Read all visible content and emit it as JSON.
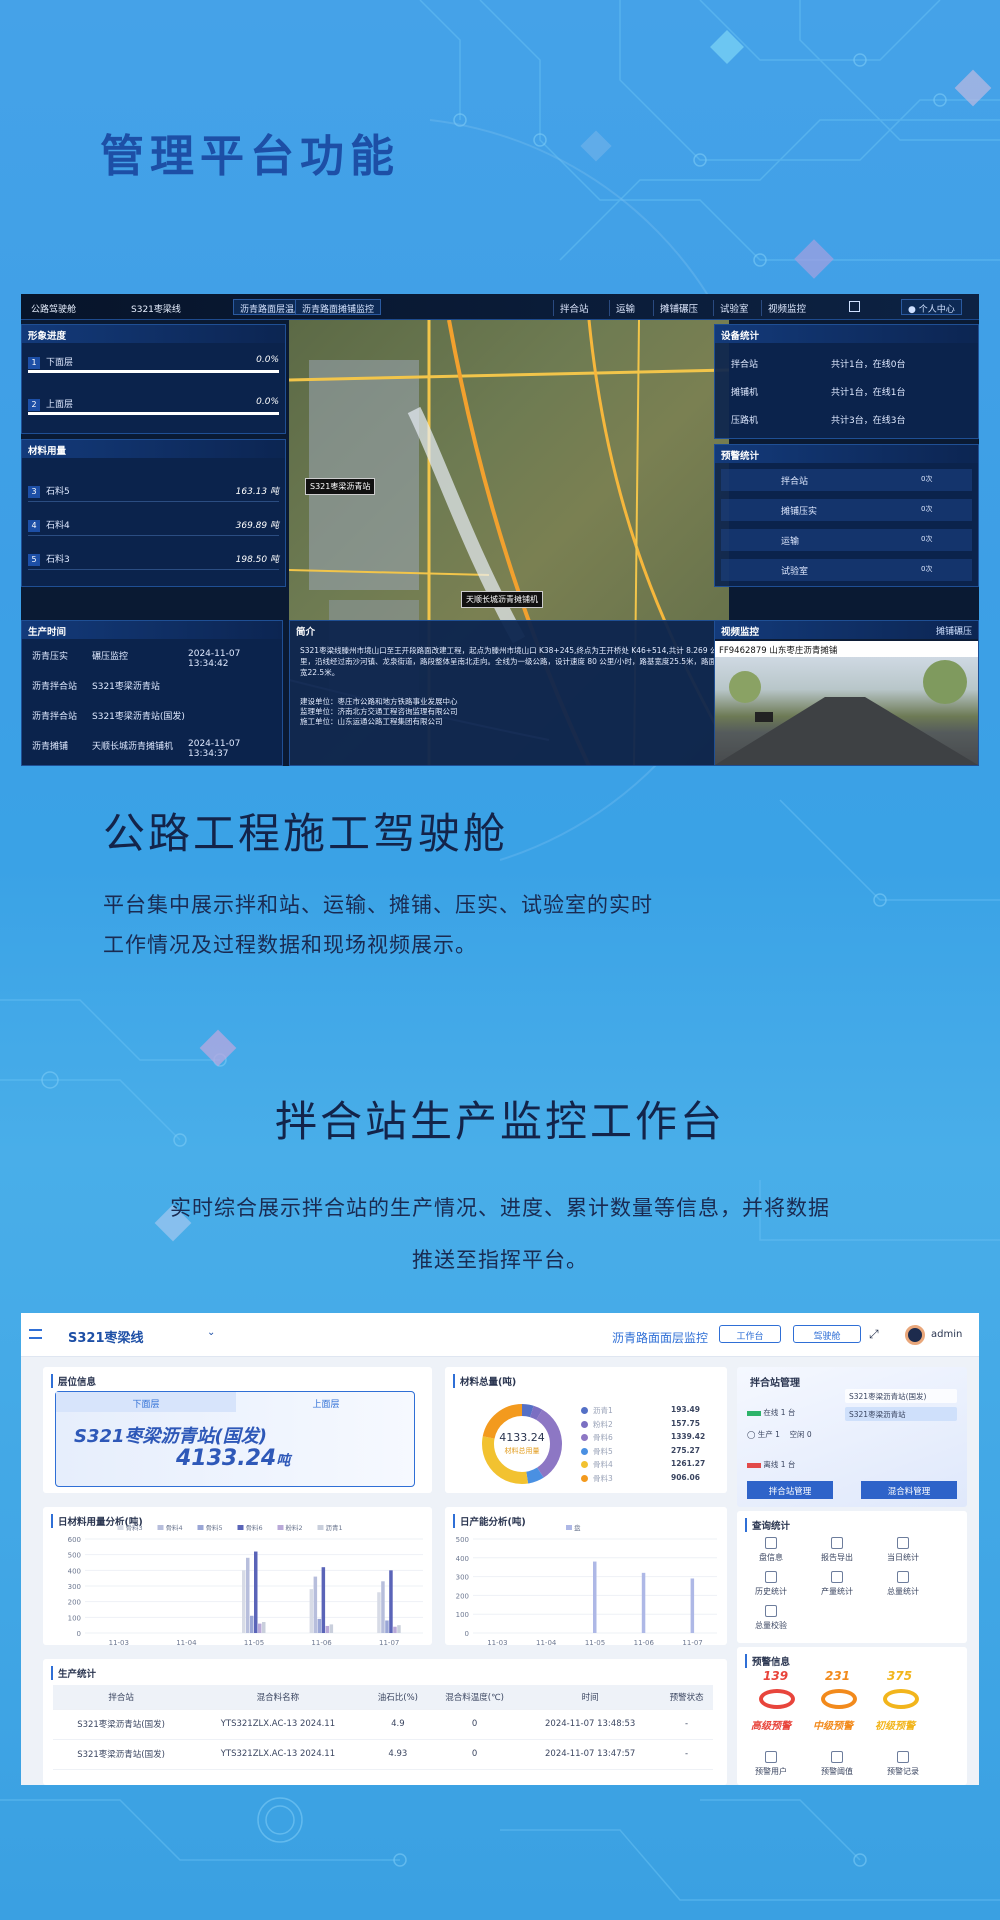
{
  "heading": "管理平台功能",
  "d1": {
    "platform": "公路驾驶舱",
    "project": "S321枣梁线",
    "tabs": [
      "沥青路面层温度监控",
      "沥青路面摊铺监控"
    ],
    "nav": [
      "拌合站",
      "运输",
      "摊铺碾压",
      "试验室",
      "视频监控"
    ],
    "user": "个人中心",
    "progress": {
      "title": "形象进度",
      "rows": [
        {
          "name": "下面层",
          "value": "0.0%"
        },
        {
          "name": "上面层",
          "value": "0.0%"
        }
      ]
    },
    "materials": {
      "title": "材料用量",
      "rows": [
        {
          "name": "石料5",
          "value": "163.13 吨"
        },
        {
          "name": "石料4",
          "value": "369.89 吨"
        },
        {
          "name": "石料3",
          "value": "198.50 吨"
        }
      ]
    },
    "prodtime": {
      "title": "生产时间",
      "rows": [
        {
          "a": "沥青压实",
          "b": "碾压监控",
          "c": "2024-11-07 13:34:42"
        },
        {
          "a": "沥青拌合站",
          "b": "S321枣梁沥青站",
          "c": ""
        },
        {
          "a": "沥青拌合站",
          "b": "S321枣梁沥青站(国发)",
          "c": ""
        },
        {
          "a": "沥青摊铺",
          "b": "天顺长城沥青摊铺机",
          "c": "2024-11-07 13:34:37"
        }
      ]
    },
    "map": {
      "label1": "S321枣梁沥青站",
      "label2": "天顺长城沥青摊铺机"
    },
    "intro": {
      "title": "简介",
      "text": "S321枣梁线滕州市境山口至王开段路面改建工程，起点为滕州市境山口 K38+245,终点为王开桥处 K46+514,共计 8.269 公里，沿线经过南沙河镇、龙泉街道，路段整体呈南北走向。全线为一级公路，设计速度 80 公里/小时，路基宽度25.5米，路面宽22.5米。",
      "units": [
        "建设单位：枣庄市公路和地方铁路事业发展中心",
        "监理单位：济南北方交通工程咨询监理有限公司",
        "施工单位：山东运通公路工程集团有限公司"
      ]
    },
    "equipment": {
      "title": "设备统计",
      "rows": [
        {
          "name": "拌合站",
          "value": "共计1台，在线0台"
        },
        {
          "name": "摊铺机",
          "value": "共计1台，在线1台"
        },
        {
          "name": "压路机",
          "value": "共计3台，在线3台"
        }
      ]
    },
    "warnings": {
      "title": "预警统计",
      "rows": [
        {
          "name": "拌合站",
          "value": "0次"
        },
        {
          "name": "摊铺压实",
          "value": "0次"
        },
        {
          "name": "运输",
          "value": "0次"
        },
        {
          "name": "试验室",
          "value": "0次"
        }
      ]
    },
    "video": {
      "title": "视频监控",
      "select": "摊铺碾压",
      "camera": "FF9462879 山东枣庄沥青摊铺"
    }
  },
  "section1": {
    "title": "公路工程施工驾驶舱",
    "lines": [
      "平台集中展示拌和站、运输、摊铺、压实、试验室的实时",
      "工作情况及过程数据和现场视频展示。"
    ]
  },
  "section2": {
    "title": "拌合站生产监控工作台",
    "lines": [
      "实时综合展示拌合站的生产情况、进度、累计数量等信息，并将数据",
      "推送至指挥平台。"
    ]
  },
  "d2": {
    "project": "S321枣梁线",
    "page_title": "沥青路面面层监控",
    "btn_workbench": "工作台",
    "btn_cockpit": "驾驶舱",
    "user": "admin",
    "layer": {
      "title": "层位信息",
      "tabs": [
        "下面层",
        "上面层"
      ],
      "station": "S321枣梁沥青站(国发)",
      "value": "4133.24",
      "unit": "吨"
    },
    "total": {
      "title": "材料总量(吨)",
      "center": "4133.24",
      "center_label": "材料总用量",
      "items": [
        {
          "name": "沥青1",
          "value": 193.49,
          "color": "#5470c6"
        },
        {
          "name": "粉料2",
          "value": 157.75,
          "color": "#7b6fc2"
        },
        {
          "name": "骨料6",
          "value": 1339.42,
          "color": "#8d77c4"
        },
        {
          "name": "骨料5",
          "value": 275.27,
          "color": "#4a90e2"
        },
        {
          "name": "骨料4",
          "value": 1261.27,
          "color": "#f2c230"
        },
        {
          "name": "骨料3",
          "value": 906.06,
          "color": "#f39a1e"
        }
      ]
    },
    "daily": {
      "title": "日材料用量分析(吨)"
    },
    "capacity": {
      "title": "日产能分析(吨)"
    },
    "prod": {
      "title": "生产统计",
      "headers": [
        "拌合站",
        "混合料名称",
        "油石比(%)",
        "混合料温度(℃)",
        "时间",
        "预警状态"
      ],
      "rows": [
        [
          "S321枣梁沥青站(国发)",
          "YTS321ZLX.AC-13 2024.11",
          "4.9",
          "0",
          "2024-11-07 13:48:53",
          "-"
        ],
        [
          "S321枣梁沥青站(国发)",
          "YTS321ZLX.AC-13 2024.11",
          "4.93",
          "0",
          "2024-11-07 13:47:57",
          "-"
        ]
      ]
    },
    "mgmt": {
      "title": "拌合站管理",
      "stations": [
        "S321枣梁沥青站(国发)",
        "S321枣梁沥青站"
      ],
      "online": "在线 1 台",
      "production": "生产 1",
      "idle": "空闲 0",
      "offline": "离线 1 台",
      "btn1": "拌合站管理",
      "btn2": "混合料管理"
    },
    "query": {
      "title": "查询统计",
      "items": [
        {
          "label": "盘信息",
          "icon": "gauge-icon"
        },
        {
          "label": "报告导出",
          "icon": "report-icon"
        },
        {
          "label": "当日统计",
          "icon": "calendar-icon"
        },
        {
          "label": "历史统计",
          "icon": "history-icon"
        },
        {
          "label": "产量统计",
          "icon": "output-icon"
        },
        {
          "label": "总量统计",
          "icon": "total-icon"
        },
        {
          "label": "总量校验",
          "icon": "verify-icon"
        }
      ]
    },
    "alert": {
      "title": "预警信息",
      "levels": [
        {
          "count": "139",
          "label": "高级预警",
          "color": "#e8453c"
        },
        {
          "count": "231",
          "label": "中级预警",
          "color": "#f28a1c"
        },
        {
          "count": "375",
          "label": "初级预警",
          "color": "#f2b51c"
        }
      ],
      "actions": [
        "预警用户",
        "预警阈值",
        "预警记录"
      ]
    }
  },
  "chart_data": [
    {
      "type": "bar",
      "title": "日材料用量分析(吨)",
      "categories": [
        "11-03",
        "11-04",
        "11-05",
        "11-06",
        "11-07"
      ],
      "ylim": [
        0,
        600
      ],
      "yticks": [
        0,
        100,
        200,
        300,
        400,
        500,
        600
      ],
      "series": [
        {
          "name": "骨料3",
          "color": "#d7dbe6",
          "values": [
            0,
            0,
            400,
            280,
            260
          ]
        },
        {
          "name": "骨料4",
          "color": "#b7bedc",
          "values": [
            0,
            0,
            480,
            360,
            330
          ]
        },
        {
          "name": "骨料5",
          "color": "#9aa6d6",
          "values": [
            0,
            0,
            110,
            90,
            80
          ]
        },
        {
          "name": "骨料6",
          "color": "#5a64b8",
          "values": [
            0,
            0,
            520,
            420,
            400
          ]
        },
        {
          "name": "粉料2",
          "color": "#b9a9d8",
          "values": [
            0,
            0,
            60,
            45,
            40
          ]
        },
        {
          "name": "沥青1",
          "color": "#c9cfdc",
          "values": [
            0,
            0,
            70,
            55,
            50
          ]
        }
      ]
    },
    {
      "type": "bar",
      "title": "日产能分析(吨)",
      "categories": [
        "11-03",
        "11-04",
        "11-05",
        "11-06",
        "11-07"
      ],
      "ylim": [
        0,
        500
      ],
      "yticks": [
        0,
        100,
        200,
        300,
        400,
        500
      ],
      "series": [
        {
          "name": "盘",
          "color": "#aeb8e6",
          "values": [
            0,
            0,
            380,
            320,
            290
          ]
        }
      ]
    }
  ]
}
